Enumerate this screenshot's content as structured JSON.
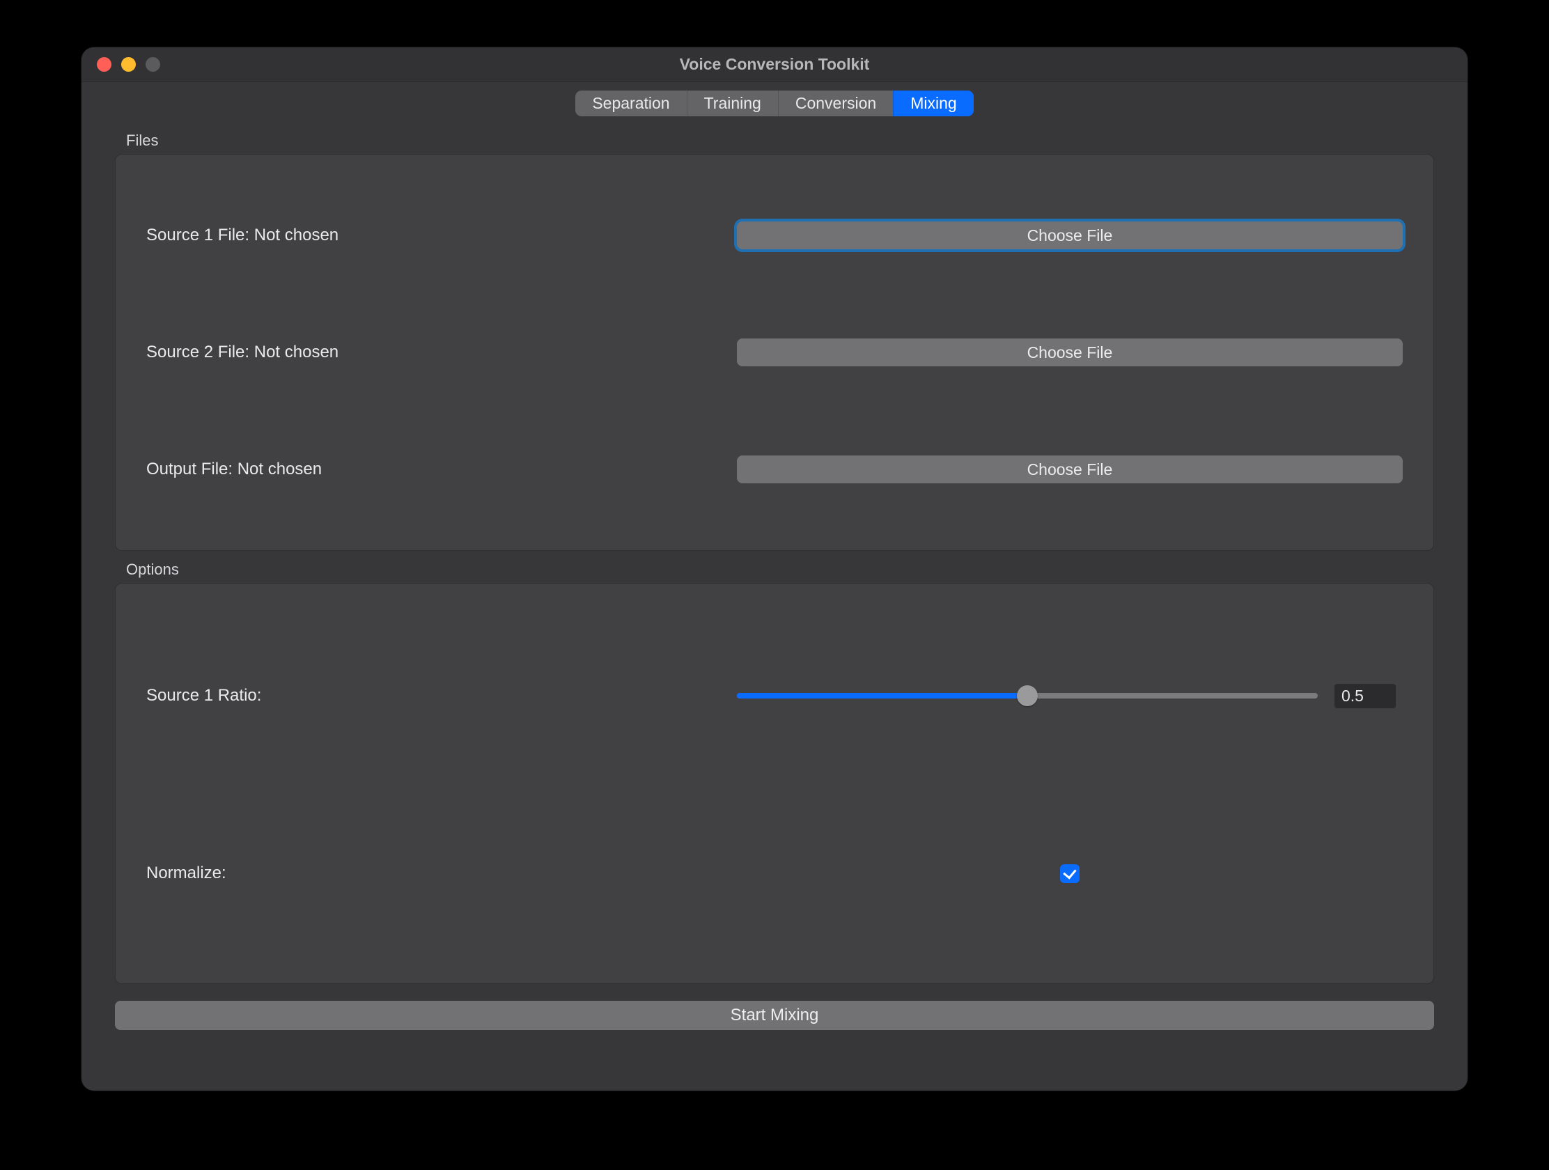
{
  "window": {
    "title": "Voice Conversion Toolkit"
  },
  "tabs": {
    "items": [
      "Separation",
      "Training",
      "Conversion",
      "Mixing"
    ],
    "active": "Mixing"
  },
  "filesGroup": {
    "label": "Files",
    "source1": {
      "label": "Source 1 File: Not chosen",
      "button": "Choose File"
    },
    "source2": {
      "label": "Source 2 File: Not chosen",
      "button": "Choose File"
    },
    "output": {
      "label": "Output File: Not chosen",
      "button": "Choose File"
    }
  },
  "optionsGroup": {
    "label": "Options",
    "ratio": {
      "label": "Source 1 Ratio:",
      "value": "0.5",
      "fraction": 0.5
    },
    "normalize": {
      "label": "Normalize:",
      "checked": true
    }
  },
  "startButton": "Start Mixing"
}
